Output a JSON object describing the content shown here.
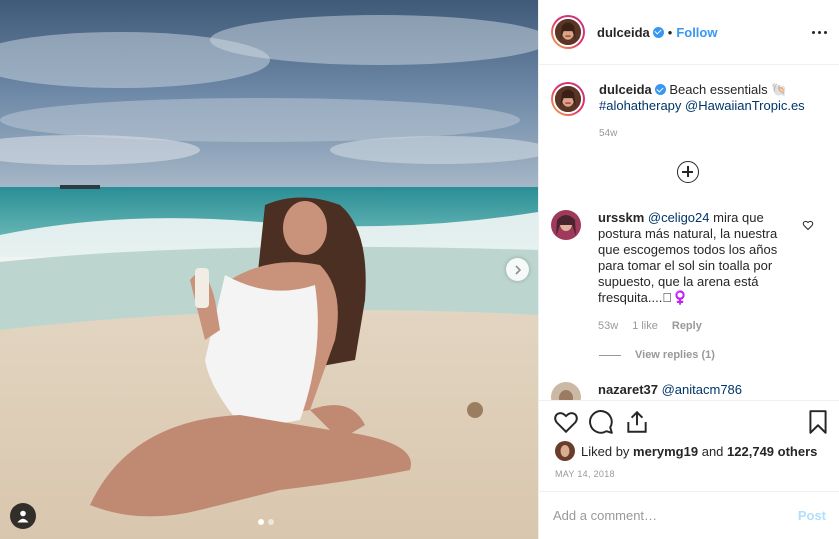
{
  "post": {
    "image_alt": "Woman in white swimsuit sitting on a beach holding a sunscreen bottle",
    "carousel": {
      "count": 2,
      "active_index": 0
    }
  },
  "header": {
    "username": "dulceida",
    "verified": true,
    "separator": "•",
    "follow_label": "Follow"
  },
  "caption": {
    "username": "dulceida",
    "text": "Beach essentials 🐚",
    "hashtag": "#alohatherapy",
    "mention": "@HawaiianTropic.es",
    "age": "54w"
  },
  "comments": [
    {
      "username": "ursskm",
      "mention": "@celigo24",
      "text": "mira que postura más natural, la nuestra que escogemos todos los años para tomar el sol sin toalla por supuesto, que la arena está fresquita....🏻‍♀️",
      "age": "53w",
      "likes": "1 like",
      "reply_label": "Reply",
      "view_replies": "View replies (1)"
    },
    {
      "username": "nazaret37",
      "mention": "@anitacm786"
    }
  ],
  "actions": {
    "liked_prefix": "Liked by",
    "liked_user": "merymg19",
    "liked_connector": "and",
    "liked_others": "122,749 others",
    "date": "MAY 14, 2018"
  },
  "add_comment": {
    "placeholder": "Add a comment…",
    "post_label": "Post"
  },
  "colors": {
    "accent": "#3897f0",
    "text": "#262626",
    "muted": "#999999",
    "link": "#003569",
    "post_disabled": "#b2dffc"
  }
}
